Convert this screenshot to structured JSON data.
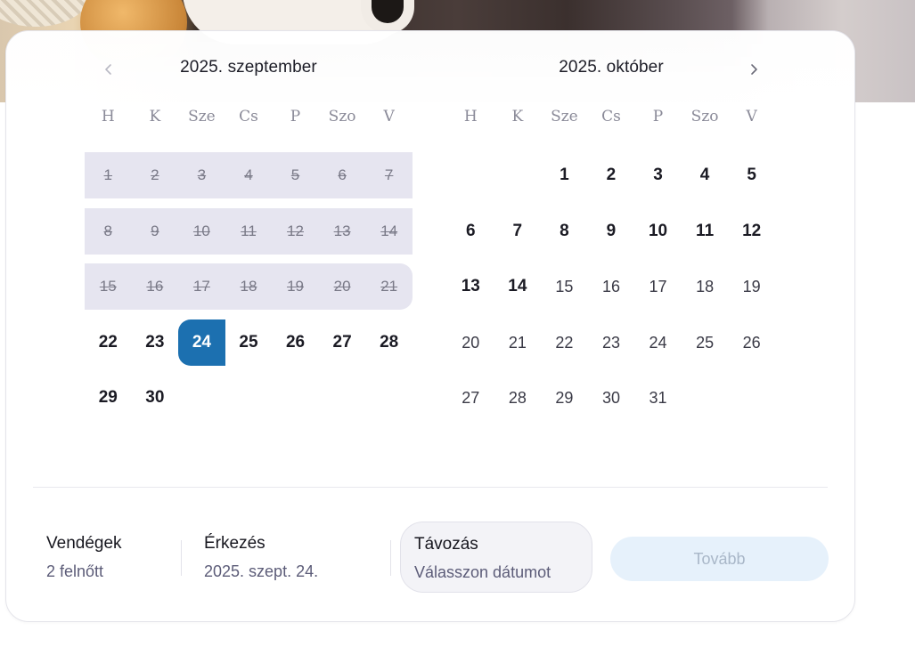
{
  "calendar": {
    "left_month": {
      "title": "2025. szeptember",
      "weekdays": [
        "H",
        "K",
        "Sze",
        "Cs",
        "P",
        "Szo",
        "V"
      ],
      "weeks": [
        [
          "1",
          "2",
          "3",
          "4",
          "5",
          "6",
          "7"
        ],
        [
          "8",
          "9",
          "10",
          "11",
          "12",
          "13",
          "14"
        ],
        [
          "15",
          "16",
          "17",
          "18",
          "19",
          "20",
          "21"
        ],
        [
          "22",
          "23",
          "24",
          "25",
          "26",
          "27",
          "28"
        ],
        [
          "29",
          "30",
          "",
          "",
          "",
          "",
          ""
        ]
      ]
    },
    "right_month": {
      "title": "2025. október",
      "weekdays": [
        "H",
        "K",
        "Sze",
        "Cs",
        "P",
        "Szo",
        "V"
      ],
      "weeks": [
        [
          "",
          "",
          "1",
          "2",
          "3",
          "4",
          "5"
        ],
        [
          "6",
          "7",
          "8",
          "9",
          "10",
          "11",
          "12"
        ],
        [
          "13",
          "14",
          "15",
          "16",
          "17",
          "18",
          "19"
        ],
        [
          "20",
          "21",
          "22",
          "23",
          "24",
          "25",
          "26"
        ],
        [
          "27",
          "28",
          "29",
          "30",
          "31",
          "",
          ""
        ]
      ]
    },
    "selected_day": "24",
    "prev_icon": "chevron-left-icon",
    "next_icon": "chevron-right-icon"
  },
  "footer": {
    "guests": {
      "label": "Vendégek",
      "value": "2 felnőtt"
    },
    "arrival": {
      "label": "Érkezés",
      "value": "2025. szept. 24."
    },
    "departure": {
      "label": "Távozás",
      "value": "Válasszon dátumot"
    },
    "next_button": "Tovább"
  },
  "colors": {
    "selected": "#1c70b0",
    "past_band": "#e6e5f0",
    "button_bg": "#e6f1fb",
    "button_text": "#a9b7c8"
  }
}
